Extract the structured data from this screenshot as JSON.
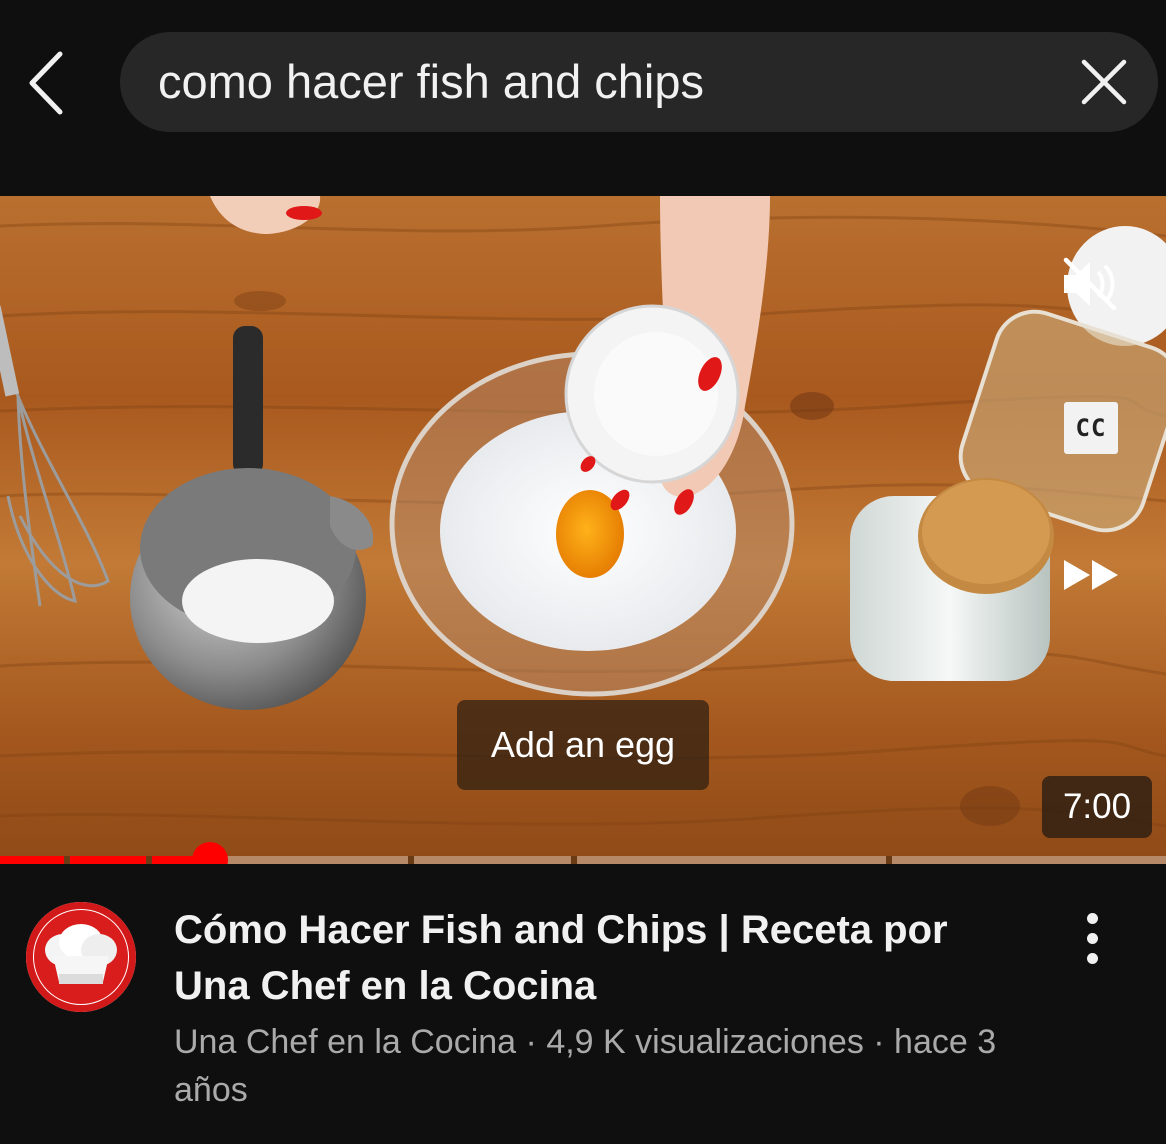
{
  "search": {
    "query": "como hacer fish and chips",
    "back_icon": "chevron-left-icon",
    "clear_icon": "close-icon"
  },
  "player": {
    "caption": "Add an egg",
    "duration": "7:00",
    "progress_fraction": 0.17,
    "chapter_markers_fraction": [
      0.055,
      0.125,
      0.35,
      0.49,
      0.76
    ],
    "controls": {
      "mute_icon": "volume-muted-icon",
      "cc_label": "CC",
      "ff_icon": "fast-forward-icon"
    }
  },
  "video": {
    "title": "Cómo Hacer Fish and Chips | Receta por Una Chef en la Cocina",
    "channel": "Una Chef en la Cocina",
    "separator": " · ",
    "views": "4,9 K visualizaciones",
    "age": "hace 3 años",
    "more_icon": "more-vertical-icon"
  },
  "colors": {
    "background": "#0f0f0f",
    "search_pill": "#272727",
    "progress": "#ff0000",
    "secondary_text": "#aaaaaa",
    "avatar_ring": "#d21919"
  }
}
